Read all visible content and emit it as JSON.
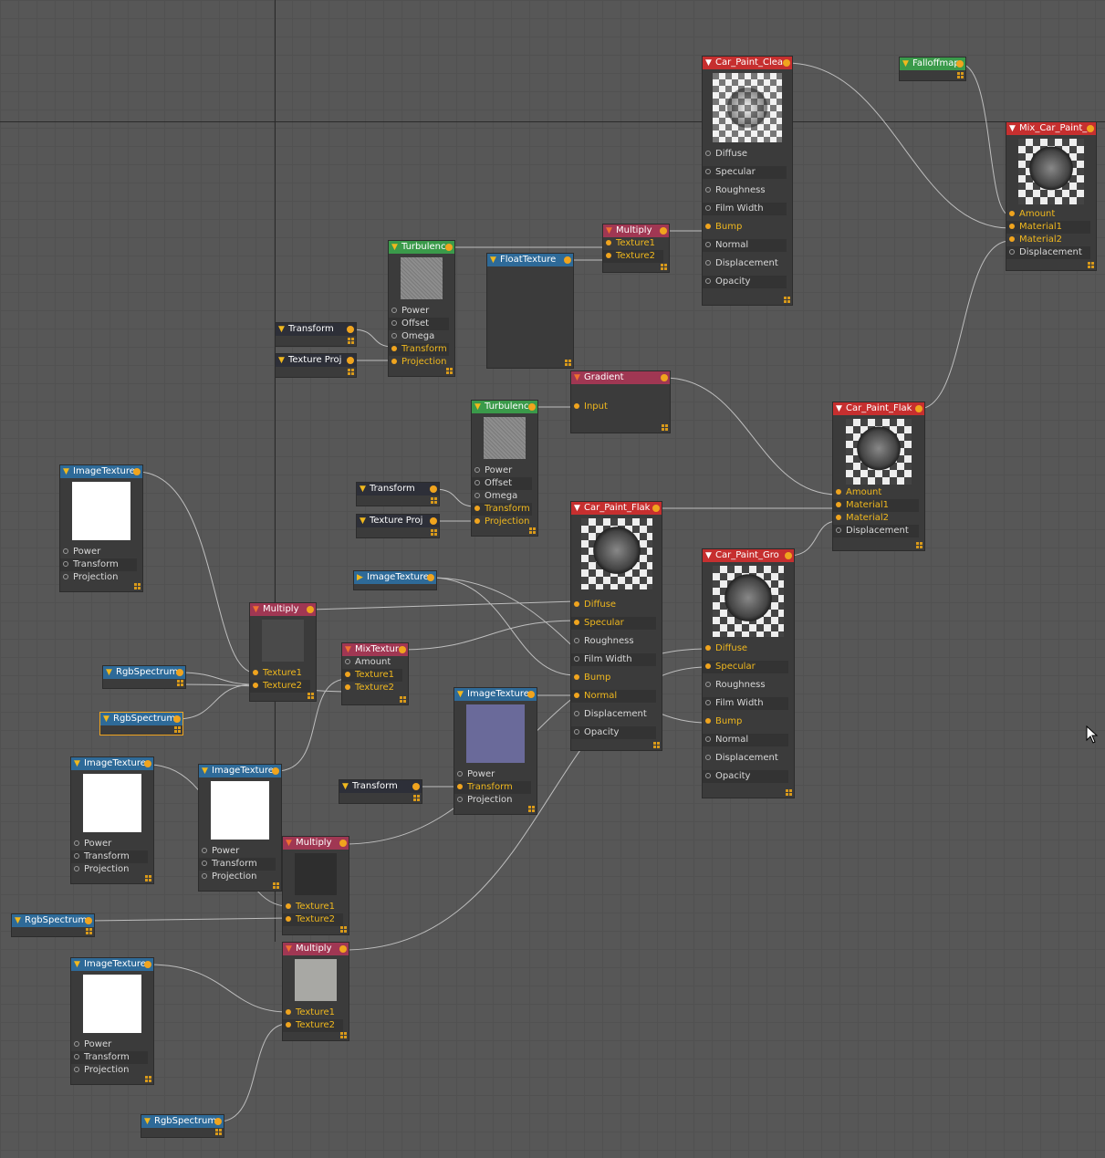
{
  "nodes": {
    "car_paint_clea": {
      "title": "Car_Paint_Clea",
      "inputs": [
        "Diffuse",
        "Specular",
        "Roughness",
        "Film Width",
        "Bump",
        "Normal",
        "Displacement",
        "Opacity"
      ]
    },
    "falloffmap": {
      "title": "Falloffmap"
    },
    "mix_car_paint": {
      "title": "Mix_Car_Paint_",
      "inputs": [
        "Amount",
        "Material1",
        "Material2",
        "Displacement"
      ]
    },
    "multiply_top": {
      "title": "Multiply",
      "inputs": [
        "Texture1",
        "Texture2"
      ]
    },
    "turbulence_1": {
      "title": "Turbulence",
      "inputs": [
        "Power",
        "Offset",
        "Omega",
        "Transform",
        "Projection"
      ]
    },
    "floattexture": {
      "title": "FloatTexture"
    },
    "transform_1": {
      "title": "Transform"
    },
    "texture_proj_1": {
      "title": "Texture Proj"
    },
    "gradient": {
      "title": "Gradient",
      "inputs": [
        "Input"
      ]
    },
    "turbulence_2": {
      "title": "Turbulence",
      "inputs": [
        "Power",
        "Offset",
        "Omega",
        "Transform",
        "Projection"
      ]
    },
    "transform_2": {
      "title": "Transform"
    },
    "texture_proj_2": {
      "title": "Texture Proj"
    },
    "car_paint_flak_2": {
      "title": "Car_Paint_Flak",
      "inputs": [
        "Amount",
        "Material1",
        "Material2",
        "Displacement"
      ]
    },
    "imagetexture_1": {
      "title": "ImageTexture",
      "inputs": [
        "Power",
        "Transform",
        "Projection"
      ]
    },
    "car_paint_flak_1": {
      "title": "Car_Paint_Flak",
      "inputs": [
        "Diffuse",
        "Specular",
        "Roughness",
        "Film Width",
        "Bump",
        "Normal",
        "Displacement",
        "Opacity"
      ]
    },
    "imagetexture_small": {
      "title": "ImageTexture"
    },
    "car_paint_gro": {
      "title": "Car_Paint_Gro",
      "inputs": [
        "Diffuse",
        "Specular",
        "Roughness",
        "Film Width",
        "Bump",
        "Normal",
        "Displacement",
        "Opacity"
      ]
    },
    "multiply_mid": {
      "title": "Multiply",
      "inputs": [
        "Texture1",
        "Texture2"
      ]
    },
    "mixtexture": {
      "title": "MixTexture",
      "inputs": [
        "Amount",
        "Texture1",
        "Texture2"
      ]
    },
    "rgbspectrum_1": {
      "title": "RgbSpectrum"
    },
    "rgbspectrum_2": {
      "title": "RgbSpectrum"
    },
    "imagetexture_3": {
      "title": "ImageTexture",
      "inputs": [
        "Power",
        "Transform",
        "Projection"
      ]
    },
    "transform_3": {
      "title": "Transform"
    },
    "imagetexture_2": {
      "title": "ImageTexture",
      "inputs": [
        "Power",
        "Transform",
        "Projection"
      ]
    },
    "imagetexture_4": {
      "title": "ImageTexture",
      "inputs": [
        "Power",
        "Transform",
        "Projection"
      ]
    },
    "multiply_3": {
      "title": "Multiply",
      "inputs": [
        "Texture1",
        "Texture2"
      ]
    },
    "rgbspectrum_3": {
      "title": "RgbSpectrum"
    },
    "imagetexture_5": {
      "title": "ImageTexture",
      "inputs": [
        "Power",
        "Transform",
        "Projection"
      ]
    },
    "multiply_4": {
      "title": "Multiply",
      "inputs": [
        "Texture1",
        "Texture2"
      ]
    },
    "rgbspectrum_4": {
      "title": "RgbSpectrum"
    }
  },
  "colors": {
    "material_header": "#c62f2f",
    "texture_header": "#2e6a98",
    "math_header": "#a03753",
    "procedural_header": "#3a9a4a",
    "utility_header": "#2d2f38",
    "port": "#f0a41e",
    "wire": "#d0d0d0"
  }
}
